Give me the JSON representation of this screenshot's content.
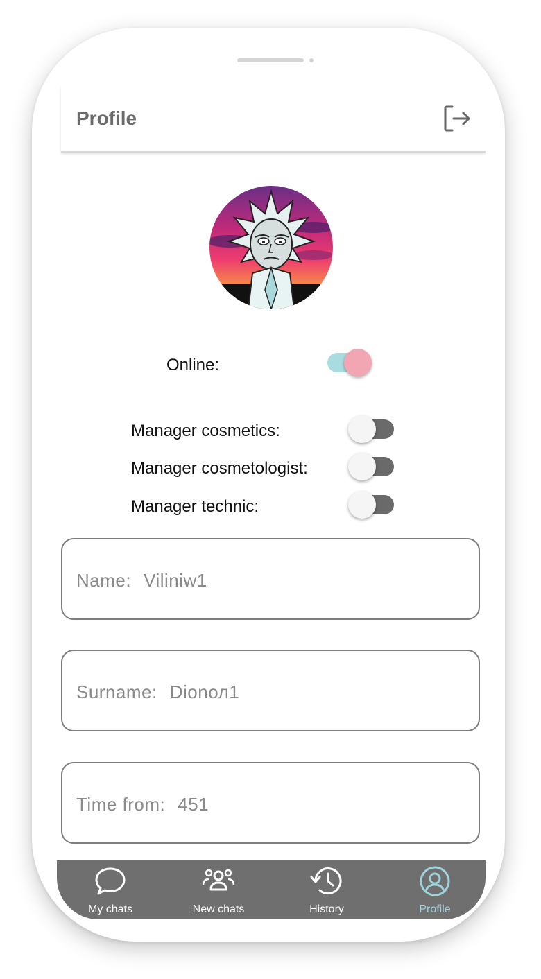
{
  "header": {
    "title": "Profile",
    "logout_icon": "logout-icon"
  },
  "profile": {
    "avatar": "avatar-cartoon-character"
  },
  "status": {
    "online_label": "Online:",
    "online": true
  },
  "roles": [
    {
      "label": "Manager cosmetics:",
      "enabled": false
    },
    {
      "label": "Manager cosmetologist:",
      "enabled": false
    },
    {
      "label": "Manager technic:",
      "enabled": false
    }
  ],
  "fields": [
    {
      "label": "Name:",
      "value": "Viliniw1"
    },
    {
      "label": "Surname:",
      "value": "Dionол1"
    },
    {
      "label": "Time from:",
      "value": "451"
    }
  ],
  "nav": {
    "items": [
      {
        "label": "My chats",
        "icon": "chat-bubble-icon"
      },
      {
        "label": "New chats",
        "icon": "group-icon"
      },
      {
        "label": "History",
        "icon": "history-icon"
      },
      {
        "label": "Profile",
        "icon": "profile-icon"
      }
    ],
    "active": "Profile"
  },
  "colors": {
    "toggle_on_track": "#a9dce0",
    "toggle_on_thumb": "#f2a6b3",
    "toggle_off_track": "#6a6a6a",
    "nav_background": "#6f6f6f",
    "nav_active": "#9fd3dc"
  }
}
